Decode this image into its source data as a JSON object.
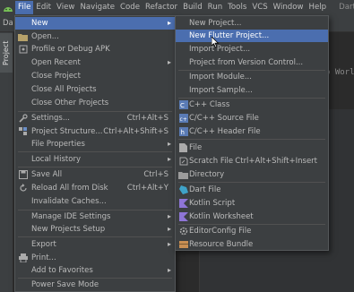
{
  "menubar": {
    "items": [
      "File",
      "Edit",
      "View",
      "Navigate",
      "Code",
      "Refactor",
      "Build",
      "Run",
      "Tools",
      "VCS",
      "Window",
      "Help"
    ],
    "right_text": "Dart"
  },
  "background": {
    "tab_text": "Da",
    "side_tab": "Project",
    "editor_text": "o Worl"
  },
  "file_menu": {
    "new": "New",
    "open": "Open...",
    "profile_debug": "Profile or Debug APK",
    "open_recent": "Open Recent",
    "close_project": "Close Project",
    "close_all_projects": "Close All Projects",
    "close_other_projects": "Close Other Projects",
    "settings": "Settings...",
    "settings_sc": "Ctrl+Alt+S",
    "project_structure": "Project Structure...",
    "project_structure_sc": "Ctrl+Alt+Shift+S",
    "file_properties": "File Properties",
    "local_history": "Local History",
    "save_all": "Save All",
    "save_all_sc": "Ctrl+S",
    "reload": "Reload All from Disk",
    "reload_sc": "Ctrl+Alt+Y",
    "invalidate": "Invalidate Caches...",
    "manage_ide": "Manage IDE Settings",
    "new_projects_setup": "New Projects Setup",
    "export": "Export",
    "print": "Print...",
    "add_favorites": "Add to Favorites",
    "power_save": "Power Save Mode"
  },
  "new_submenu": {
    "new_project": "New Project...",
    "new_flutter_project": "New Flutter Project...",
    "import_project": "Import Project...",
    "project_from_vcs": "Project from Version Control...",
    "import_module": "Import Module...",
    "import_sample": "Import Sample...",
    "cpp_class": "C++ Class",
    "cpp_source": "C/C++ Source File",
    "cpp_header": "C/C++ Header File",
    "file": "File",
    "scratch_file": "Scratch File",
    "scratch_file_sc": "Ctrl+Alt+Shift+Insert",
    "directory": "Directory",
    "dart_file": "Dart File",
    "kotlin_script": "Kotlin Script",
    "kotlin_worksheet": "Kotlin Worksheet",
    "editorconfig": "EditorConfig File",
    "resource_bundle": "Resource Bundle"
  },
  "colors": {
    "highlight": "#4b6eaf",
    "menu_bg": "#3c3f41",
    "text": "#bbbbbb"
  }
}
